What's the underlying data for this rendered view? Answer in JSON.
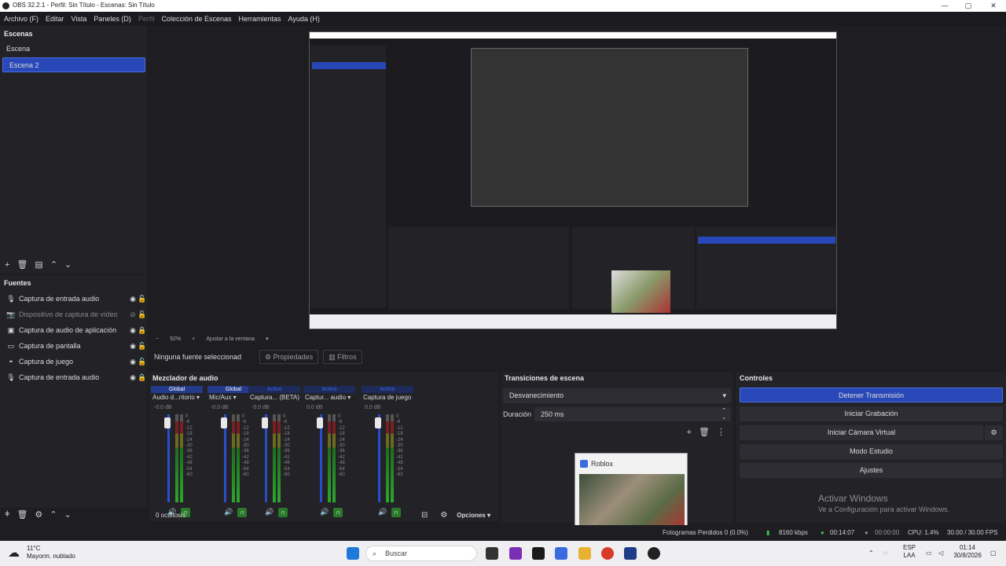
{
  "window": {
    "title": "OBS 32.2.1 - Perfil: Sin Título - Escenas: Sin Título"
  },
  "menu": {
    "items": [
      "Archivo (F)",
      "Editar",
      "Vista",
      "Paneles (D)",
      "Perfil",
      "Colección de Escenas",
      "Herramientas",
      "Ayuda (H)"
    ]
  },
  "scenes": {
    "header": "Escenas",
    "items": [
      "Escena",
      "Escena 2"
    ]
  },
  "sources": {
    "header": "Fuentes",
    "items": [
      "Captura de entrada audio",
      "Dispositivo de captura de vídeo",
      "Captura de audio de aplicación",
      "Captura de pantalla",
      "Captura de juego",
      "Captura de entrada audio"
    ]
  },
  "preview": {
    "zoom": "92%",
    "fit": "Ajustar a la ventana"
  },
  "sourcebar": {
    "none_selected": "Ninguna fuente seleccionad",
    "properties": "Propiedades",
    "filters": "Filtros"
  },
  "mixer": {
    "header": "Mezclador de audio",
    "channels": [
      {
        "badge": "Global",
        "name": "Audio d...ritorio",
        "db": "-0.0 dB"
      },
      {
        "badge": "Global",
        "name": "Mic/Aux",
        "db": "-0.0 dB"
      },
      {
        "badge": "Activo",
        "name": "Captura... (BETA)",
        "db": "-0.0 dB"
      },
      {
        "badge": "Activo",
        "name": "Captur... audio",
        "db": "0.0 dB"
      },
      {
        "badge": "Activo",
        "name": "Captura de juego",
        "db": "0.0 dB"
      }
    ],
    "ticks": [
      "0",
      "-6",
      "-12",
      "-18",
      "-24",
      "-30",
      "-36",
      "-42",
      "-48",
      "-54",
      "-60"
    ],
    "hidden": "0 ocultos/s",
    "options": "Opciones"
  },
  "transitions": {
    "header": "Transiciones de escena",
    "selected": "Desvanecimiento",
    "duration_label": "Duración",
    "duration_value": "250 ms"
  },
  "controls": {
    "header": "Controles",
    "buttons": [
      "Detener Transmisión",
      "Iniciar Grabación",
      "Iniciar Cámara Virtual",
      "Modo Estudio",
      "Ajustes"
    ]
  },
  "thumbnail": {
    "title": "Roblox"
  },
  "watermark": {
    "line1": "Activar Windows",
    "line2": "Ve a Configuración para activar Windows."
  },
  "status": {
    "frames": "Fotogramas Perdidos 0 (0.0%)",
    "bitrate": "8160 kbps",
    "stream_time": "00:14:07",
    "rec_time": "00:00:00",
    "cpu": "CPU: 1.4%",
    "fps": "30.00 / 30.00 FPS"
  },
  "taskbar": {
    "temp": "11°C",
    "weather": "Mayorm. nublado",
    "search": "Buscar",
    "lang1": "ESP",
    "lang2": "LAA",
    "time": "01:14",
    "date": "30/8/2026"
  }
}
